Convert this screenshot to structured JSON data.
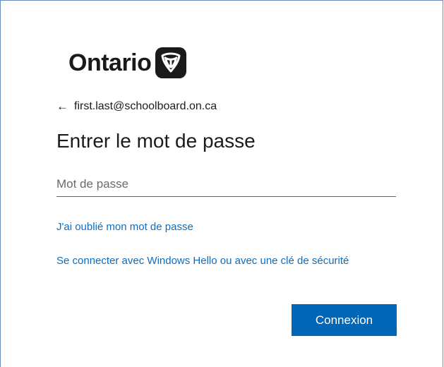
{
  "brand": {
    "logo_text": "Ontario",
    "logo_icon": "ontario-trillium-icon"
  },
  "account": {
    "back_icon": "back-arrow-icon",
    "back_arrow_glyph": "←",
    "email": "first.last@schoolboard.on.ca"
  },
  "form": {
    "title": "Entrer le mot de passe",
    "password_placeholder": "Mot de passe",
    "password_value": ""
  },
  "links": {
    "forgot_password": "J'ai oublié mon mot de passe",
    "windows_hello": "Se connecter avec Windows Hello ou avec une clé de sécurité"
  },
  "actions": {
    "submit_label": "Connexion"
  },
  "colors": {
    "accent": "#0067b8",
    "link": "#0f6cbd",
    "frame_border": "#6b8bbd"
  }
}
